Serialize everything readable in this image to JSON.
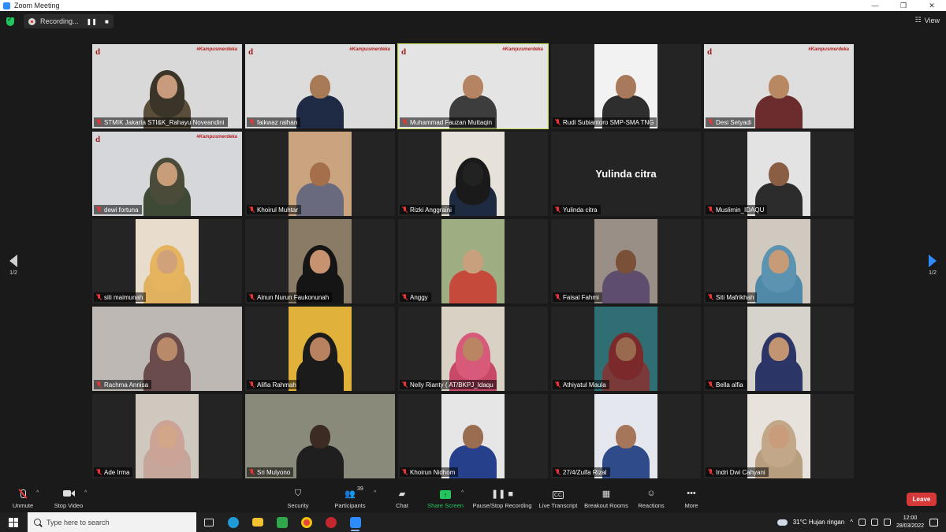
{
  "window": {
    "title": "Zoom Meeting",
    "minimize": "—",
    "restore": "❐",
    "close": "✕"
  },
  "recording": {
    "label": "Recording...",
    "pause_icon": "pause-icon",
    "stop_icon": "stop-icon",
    "pause_glyph": "❚❚",
    "stop_glyph": "■"
  },
  "view": {
    "label": "View"
  },
  "pager": {
    "left": "1/2",
    "right": "1/2"
  },
  "participants": [
    {
      "name": "STMIK Jakarta STI&K_Rahayu Noveandini",
      "bg": "#d9d9d9",
      "style": "banner",
      "skin": "#c79b7c",
      "wear": "#5a4e3a",
      "hijab": "#3a3528"
    },
    {
      "name": "faikwaz raihan",
      "bg": "#dcdcdc",
      "style": "banner",
      "skin": "#a87a55",
      "wear": "#1f2a44"
    },
    {
      "name": "Muhammad Fauzan Muttaqin",
      "bg": "#e4e4e4",
      "style": "banner",
      "skin": "#b58462",
      "wear": "#3d3d3d",
      "active": true
    },
    {
      "name": "Rudi Subiantoro SMP-SMA TNG",
      "bg": "#f2f2f2",
      "style": "cam",
      "skin": "#a8795b",
      "wear": "#2e2e2e"
    },
    {
      "name": "Desi Setyadi",
      "bg": "#dedede",
      "style": "banner",
      "skin": "#b88863",
      "wear": "#6a2c2c"
    },
    {
      "name": "dewi fortuna",
      "bg": "#d5d7db",
      "style": "banner",
      "skin": "#c89d79",
      "wear": "#3f4a36",
      "hijab": "#4b4b3a"
    },
    {
      "name": "Khoirul Muhtar",
      "bg": "#c9a47e",
      "style": "cam",
      "skin": "#a66f4c",
      "wear": "#6a6a7e"
    },
    {
      "name": "Rizki Anggraini",
      "bg": "#e6e2da",
      "style": "cam",
      "skin": "#222222",
      "wear": "#1e2a40",
      "hijab": "#1a1a1a"
    },
    {
      "name": "Yulinda citra",
      "bg": "#242424",
      "style": "nocam"
    },
    {
      "name": "Muslimin_IDAQU",
      "bg": "#e3e3e3",
      "style": "cam",
      "skin": "#8a5e42",
      "wear": "#2c2c2c"
    },
    {
      "name": "siti maimunah",
      "bg": "#e8dccd",
      "style": "cam",
      "skin": "#d1a27a",
      "wear": "#e0b260",
      "hijab": "#e6b45e"
    },
    {
      "name": "Ainun Nurun Faukonunah",
      "bg": "#8a7b66",
      "style": "cam",
      "skin": "#c69270",
      "wear": "#151515",
      "hijab": "#151515"
    },
    {
      "name": "Anggy",
      "bg": "#9fae82",
      "style": "cam",
      "skin": "#c9a07e",
      "wear": "#c64a3c"
    },
    {
      "name": "Faisal Fahmi",
      "bg": "#9a8f86",
      "style": "cam",
      "skin": "#7a5038",
      "wear": "#5f4d6e"
    },
    {
      "name": "Siti Mafrikhah",
      "bg": "#cfc9c0",
      "style": "cam",
      "skin": "#c79a78",
      "wear": "#4e89a8",
      "hijab": "#5c93b0"
    },
    {
      "name": "Rachma Annisa",
      "bg": "#bdb8b4",
      "style": "wide",
      "skin": "#b98a6a",
      "wear": "#6a4c4c",
      "hijab": "#6a4c4c"
    },
    {
      "name": "Alifia Rahmah",
      "bg": "#e0b23a",
      "style": "cam",
      "skin": "#b88260",
      "wear": "#1b1b1b",
      "hijab": "#1b1b1b"
    },
    {
      "name": "Nelly Rianty ( AT/BKPJ_Idaqu",
      "bg": "#d8d1c4",
      "style": "cam",
      "skin": "#b98563",
      "wear": "#c84868",
      "hijab": "#d75a7a"
    },
    {
      "name": "Athiyatul Maula",
      "bg": "#2f6f74",
      "style": "cam",
      "skin": "#9a6a4e",
      "wear": "#7a3a3a",
      "hijab": "#7a2a2a"
    },
    {
      "name": "Bella alfia",
      "bg": "#d6d2cc",
      "style": "cam",
      "skin": "#c39472",
      "wear": "#2b3566",
      "hijab": "#2b3566"
    },
    {
      "name": "Ade Irma",
      "bg": "#cfc8bf",
      "style": "cam",
      "skin": "#d2a789",
      "wear": "#c6a69a",
      "hijab": "#cba497"
    },
    {
      "name": "Sri Mulyono",
      "bg": "#8a8a7a",
      "style": "wide",
      "skin": "#3b2b22",
      "wear": "#1f1f1f"
    },
    {
      "name": "Khoirun Nidhom",
      "bg": "#e6e6e6",
      "style": "cam",
      "skin": "#9a6c50",
      "wear": "#27408b"
    },
    {
      "name": "27/4/Zulfa Rizal",
      "bg": "#e4e8ee",
      "style": "cam",
      "skin": "#a5765a",
      "wear": "#2f4b8a"
    },
    {
      "name": "Indri Dwi Cahyani",
      "bg": "#e7e2dc",
      "style": "cam",
      "skin": "#c99c7c",
      "wear": "#b79e7e",
      "hijab": "#c2a889"
    }
  ],
  "banner": {
    "logo": "d",
    "hashtag": "#Kampusmerdeka"
  },
  "toolbar": {
    "unmute": "Unmute",
    "stop_video": "Stop Video",
    "security": "Security",
    "participants": "Participants",
    "participants_count": "39",
    "chat": "Chat",
    "share_screen": "Share Screen",
    "pause_stop_recording": "Pause/Stop Recording",
    "live_transcript": "Live Transcript",
    "breakout_rooms": "Breakout Rooms",
    "reactions": "Reactions",
    "more": "More",
    "leave": "Leave",
    "cc": "CC",
    "caret": "^",
    "more_glyph": "•••"
  },
  "taskbar": {
    "search_placeholder": "Type here to search",
    "weather": "31°C  Hujan ringan",
    "time": "12:00",
    "date": "28/03/2022"
  },
  "colors": {
    "accent_green": "#23c55e",
    "leave_red": "#d73838",
    "active_speaker": "#b9d84a",
    "zoom_blue": "#2d8cff"
  }
}
